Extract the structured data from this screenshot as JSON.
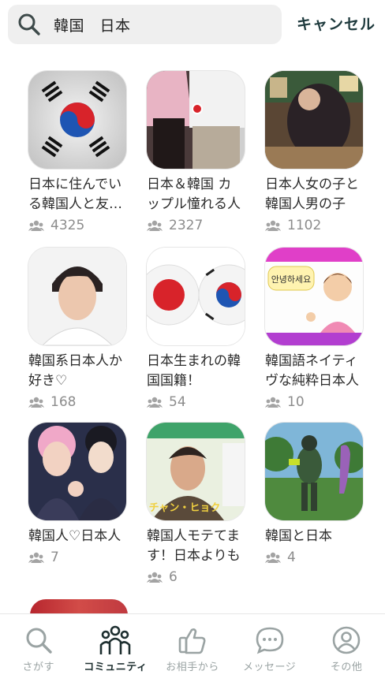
{
  "search": {
    "value": "韓国　日本",
    "cancel_label": "キャンセル"
  },
  "communities": [
    {
      "title_lines": [
        "日本に住んでい",
        "る韓国人と友…"
      ],
      "members": "4325"
    },
    {
      "title_lines": [
        "日本＆韓国 カ",
        "ップル憧れる人"
      ],
      "members": "2327"
    },
    {
      "title_lines": [
        "日本人女の子と",
        "韓国人男の子"
      ],
      "members": "1102"
    },
    {
      "title_lines": [
        "韓国系日本人か",
        "好き♡"
      ],
      "members": "168"
    },
    {
      "title_lines": [
        "日本生まれの韓",
        "国国籍！"
      ],
      "members": "54"
    },
    {
      "title_lines": [
        "韓国語ネイティ",
        "ヴな純粋日本人"
      ],
      "members": "10"
    },
    {
      "title_lines": [
        "韓国人♡日本人",
        ""
      ],
      "members": "7"
    },
    {
      "title_lines": [
        "韓国人モテてま",
        "す！日本よりも"
      ],
      "members": "6"
    },
    {
      "title_lines": [
        "韓国と日本",
        ""
      ],
      "members": "4"
    }
  ],
  "thumb_text": {
    "korean_greeting": "안녕하세요",
    "magazine_caption": "チャン・ヒョク"
  },
  "tabs": [
    {
      "label": "さがす",
      "icon": "search-icon"
    },
    {
      "label": "コミュニティ",
      "icon": "community-icon"
    },
    {
      "label": "お相手から",
      "icon": "thumbs-up-icon"
    },
    {
      "label": "メッセージ",
      "icon": "message-icon"
    },
    {
      "label": "その他",
      "icon": "profile-icon"
    }
  ],
  "colors": {
    "active_tab": "#1e2f30",
    "inactive_tab": "#9aa3a3",
    "cancel": "#1e3a3d"
  }
}
